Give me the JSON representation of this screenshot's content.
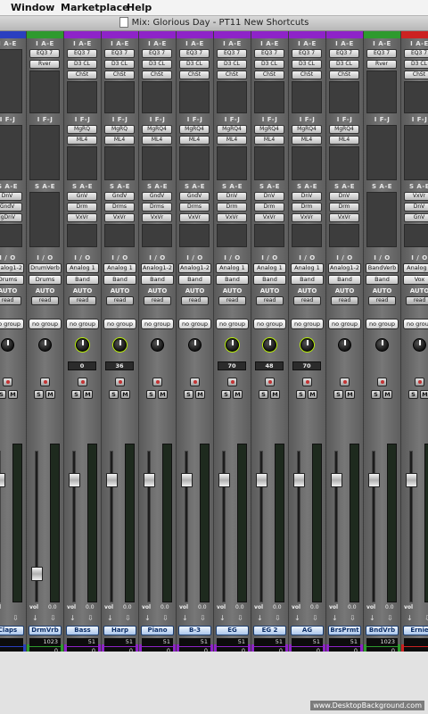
{
  "menubar": {
    "window": "Window",
    "marketplace": "Marketplace",
    "help": "Help"
  },
  "window_title": "Mix: Glorious Day - PT11 New Shortcuts",
  "section_labels": {
    "inserts_ae": "I A-E",
    "inserts_fj": "I F-J",
    "sends_ae": "S A-E",
    "io": "I / O",
    "auto": "AUTO"
  },
  "watermark": "www.DesktopBackground.com",
  "strips": [
    {
      "name": "Claps",
      "color": "#2a3fc0",
      "ins_ae": [],
      "ins_fj": [],
      "sends": [
        "DnV",
        "GndV",
        "lgDnV"
      ],
      "in": "Analog1-2",
      "out": "Drums",
      "auto": "read",
      "group": "no group",
      "pan": "",
      "vol": "",
      "nums": [
        "",
        "",
        ""
      ]
    },
    {
      "name": "DrmVrb",
      "color": "#2e9a2e",
      "ins_ae": [
        "EQ3 7",
        "Rver"
      ],
      "ins_fj": [],
      "sends": [],
      "in": "DrumVerb",
      "out": "Drums",
      "auto": "read",
      "group": "no group",
      "pan": "",
      "vol": "0.0",
      "nums": [
        "1023",
        "0",
        "1023"
      ]
    },
    {
      "name": "Bass",
      "color": "#8e23c8",
      "ins_ae": [
        "EQ3 7",
        "D3 CL",
        "ChSt"
      ],
      "ins_fj": [
        "MgRQ",
        "ML4"
      ],
      "sends": [
        "GnV",
        "Drm",
        "VxVr"
      ],
      "in": "Analog 1",
      "out": "Band",
      "auto": "read",
      "group": "no group",
      "pan": "0",
      "vol": "0.0",
      "nums": [
        "51",
        "0",
        "1023"
      ]
    },
    {
      "name": "Harp",
      "color": "#8e23c8",
      "ins_ae": [
        "EQ3 7",
        "D3 CL",
        "ChSt"
      ],
      "ins_fj": [
        "MgRQ",
        "ML4"
      ],
      "sends": [
        "GndV",
        "Drms",
        "VxVr"
      ],
      "in": "Analog 1",
      "out": "Band",
      "auto": "read",
      "group": "no group",
      "pan": "36",
      "vol": "0.0",
      "nums": [
        "51",
        "0",
        "1023"
      ]
    },
    {
      "name": "Piano",
      "color": "#8e23c8",
      "ins_ae": [
        "EQ3 7",
        "D3 CL",
        "ChSt"
      ],
      "ins_fj": [
        "MgRQ4",
        "ML4"
      ],
      "sends": [
        "GndV",
        "Drms",
        "VxVr"
      ],
      "in": "Analog1-2",
      "out": "Band",
      "auto": "read",
      "group": "no group",
      "pan": "",
      "vol": "0.0",
      "nums": [
        "51",
        "0",
        "1023"
      ]
    },
    {
      "name": "B-3",
      "color": "#8e23c8",
      "ins_ae": [
        "EQ3 7",
        "D3 CL",
        "ChSt"
      ],
      "ins_fj": [
        "MgRQ4",
        "ML4"
      ],
      "sends": [
        "GndV",
        "Drms",
        "VxVr"
      ],
      "in": "Analog1-2",
      "out": "Band",
      "auto": "read",
      "group": "no group",
      "pan": "",
      "vol": "0.0",
      "nums": [
        "51",
        "0",
        "1023"
      ]
    },
    {
      "name": "EG",
      "color": "#8e23c8",
      "ins_ae": [
        "EQ3 7",
        "D3 CL",
        "ChSt"
      ],
      "ins_fj": [
        "MgRQ4",
        "ML4"
      ],
      "sends": [
        "DnV",
        "Drm",
        "VxVr"
      ],
      "in": "Analog 1",
      "out": "Band",
      "auto": "read",
      "group": "no group",
      "pan": "70",
      "vol": "0.0",
      "nums": [
        "51",
        "0",
        "1023"
      ]
    },
    {
      "name": "EG 2",
      "color": "#8e23c8",
      "ins_ae": [
        "EQ3 7",
        "D3 CL",
        "ChSt"
      ],
      "ins_fj": [
        "MgRQ4",
        "ML4"
      ],
      "sends": [
        "DnV",
        "Drm",
        "VxVr"
      ],
      "in": "Analog 1",
      "out": "Band",
      "auto": "read",
      "group": "no group",
      "pan": "48",
      "vol": "0.0",
      "nums": [
        "51",
        "0",
        "1023"
      ]
    },
    {
      "name": "AG",
      "color": "#8e23c8",
      "ins_ae": [
        "EQ3 7",
        "D3 CL",
        "ChSt"
      ],
      "ins_fj": [
        "MgRQ4",
        "ML4"
      ],
      "sends": [
        "DnV",
        "Drm",
        "VxVr"
      ],
      "in": "Analog 1",
      "out": "Band",
      "auto": "read",
      "group": "no group",
      "pan": "70",
      "vol": "0.0",
      "nums": [
        "51",
        "0",
        "1023"
      ]
    },
    {
      "name": "BrsPrmt",
      "color": "#8e23c8",
      "ins_ae": [
        "EQ3 7",
        "D3 CL",
        "ChSt"
      ],
      "ins_fj": [
        "MgRQ4",
        "ML4"
      ],
      "sends": [
        "DnV",
        "Drm",
        "VxVr"
      ],
      "in": "Analog1-2",
      "out": "Band",
      "auto": "read",
      "group": "no group",
      "pan": "",
      "vol": "0.0",
      "nums": [
        "51",
        "0",
        "1023"
      ]
    },
    {
      "name": "BndVrb",
      "color": "#2e9a2e",
      "ins_ae": [
        "EQ3 7",
        "Rver"
      ],
      "ins_fj": [],
      "sends": [],
      "in": "BandVerb",
      "out": "Band",
      "auto": "read",
      "group": "no group",
      "pan": "",
      "vol": "0.0",
      "nums": [
        "1023",
        "0",
        "1023"
      ]
    },
    {
      "name": "Ernie",
      "color": "#cc2222",
      "ins_ae": [
        "EQ3 7",
        "D3 CL",
        "ChSt"
      ],
      "ins_fj": [],
      "sends": [
        "VxVr",
        "DnV",
        "GnV"
      ],
      "in": "Analog 1",
      "out": "Vox",
      "auto": "read",
      "group": "no group",
      "pan": "",
      "vol": "",
      "nums": [
        "",
        "",
        ""
      ]
    }
  ]
}
